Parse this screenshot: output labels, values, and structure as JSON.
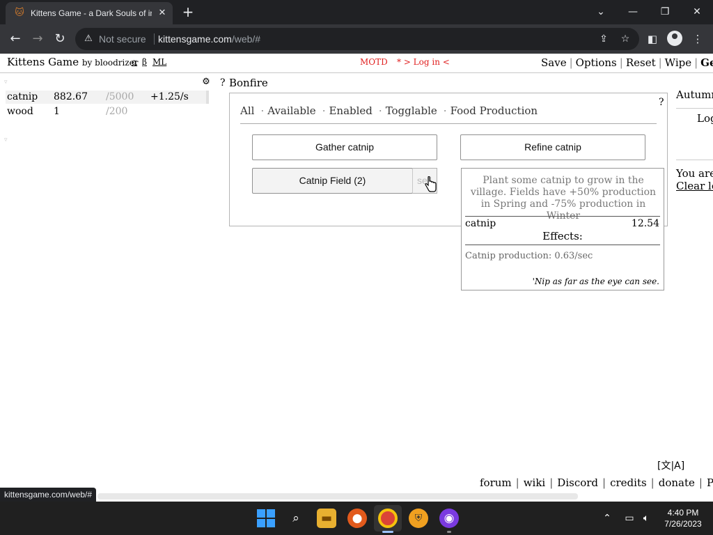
{
  "browser": {
    "tab_title": "Kittens Game - a Dark Souls of incremental games",
    "tab_close": "✕",
    "new_tab": "+",
    "security_label": "Not secure",
    "url_host": "kittensgame.com",
    "url_path": "/web/#",
    "status_url": "kittensgame.com/web/#"
  },
  "header": {
    "title": "Kittens Game",
    "by": "by bloodrizer",
    "links": [
      "α",
      "β",
      "ML"
    ],
    "motd": "MOTD",
    "login": "* > Log in <",
    "menu": [
      "Save",
      "Options",
      "Reset",
      "Wipe",
      "Get the"
    ]
  },
  "resources": [
    {
      "name": "catnip",
      "amount": "882.67",
      "max": "/5000",
      "rate": "+1.25/s"
    },
    {
      "name": "wood",
      "amount": "1",
      "max": "/200",
      "rate": ""
    }
  ],
  "bonfire": {
    "help": "?",
    "title": "Bonfire",
    "panel_help": "?",
    "filters": [
      "All",
      "Available",
      "Enabled",
      "Togglable",
      "Food Production"
    ],
    "buttons": {
      "gather": "Gather catnip",
      "refine": "Refine catnip",
      "field": "Catnip Field (2)",
      "sell": "sell"
    }
  },
  "tooltip": {
    "description": "Plant some catnip to grow in the village. Fields have +50% production in Spring and -75% production in Winter",
    "price_name": "catnip",
    "price_value": "12.54",
    "effects_title": "Effects:",
    "effect": "Catnip production: 0.63/sec",
    "flavor": "'Nip as far as the eye can see."
  },
  "right_column": {
    "season": "Autumn",
    "log_label": "Log",
    "you_are": "You are",
    "clear_log": "Clear log"
  },
  "footer": {
    "lang": "[文|A]",
    "links": [
      "forum",
      "wiki",
      "Discord",
      "credits",
      "donate",
      "Patreon"
    ]
  },
  "system": {
    "time": "4:40 PM",
    "date": "7/26/2023"
  },
  "colors": {
    "accent_red": "#e02020",
    "chrome_dark": "#202124",
    "chrome_toolbar": "#35363a"
  }
}
